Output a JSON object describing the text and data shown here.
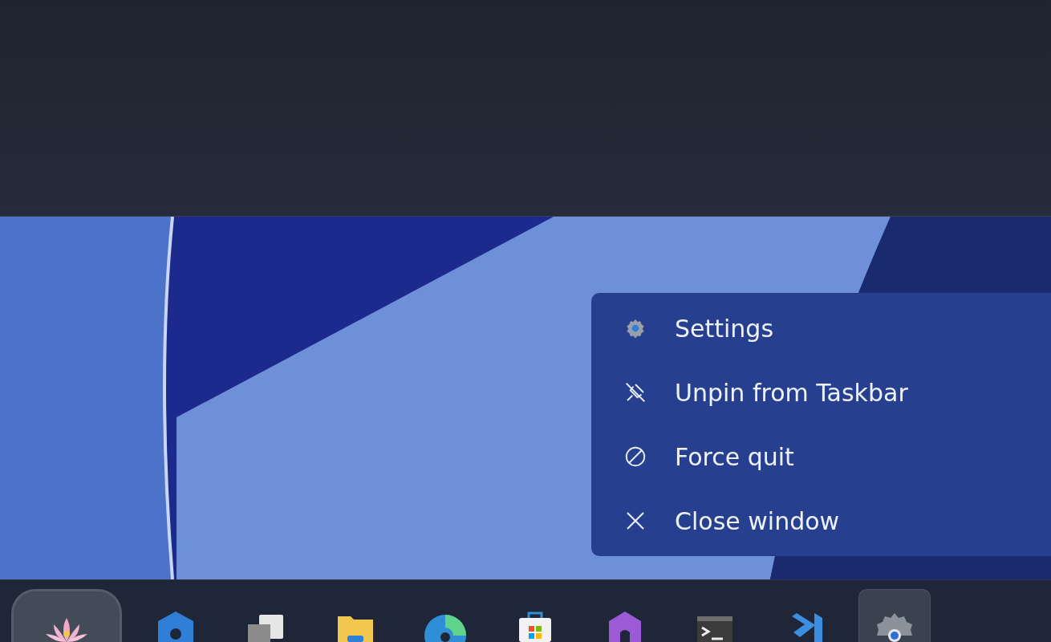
{
  "context_menu": {
    "items": [
      {
        "label": "Settings",
        "kind": "settings"
      },
      {
        "label": "Unpin from Taskbar",
        "kind": "unpin"
      },
      {
        "label": "Force quit",
        "kind": "force-quit"
      },
      {
        "label": "Close window",
        "kind": "close"
      }
    ]
  },
  "taskbar": {
    "items": [
      {
        "kind": "start",
        "selected": false
      },
      {
        "kind": "copilot",
        "selected": false
      },
      {
        "kind": "task-view",
        "selected": false
      },
      {
        "kind": "folder",
        "selected": false
      },
      {
        "kind": "browser",
        "selected": false
      },
      {
        "kind": "store",
        "selected": false
      },
      {
        "kind": "hex",
        "selected": false
      },
      {
        "kind": "terminal",
        "selected": false
      },
      {
        "kind": "code",
        "selected": false
      },
      {
        "kind": "settings",
        "selected": true
      }
    ]
  }
}
